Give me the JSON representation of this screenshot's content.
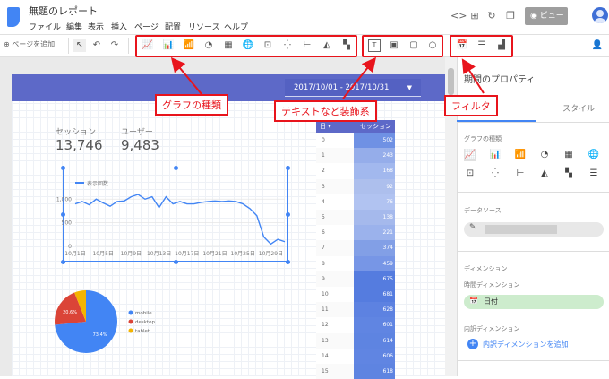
{
  "app": {
    "title": "無題のレポート"
  },
  "menu": [
    "ファイル",
    "編集",
    "表示",
    "挿入",
    "ページ",
    "配置",
    "リソース",
    "ヘルプ"
  ],
  "top_right": {
    "view_label": "ビュー"
  },
  "toolbar": {
    "add_page": "ページを追加"
  },
  "report": {
    "date_range": "2017/10/01 - 2017/10/31",
    "kpis": [
      {
        "label": "セッション",
        "value": "13,746"
      },
      {
        "label": "ユーザー",
        "value": "9,483"
      }
    ],
    "chart_data": [
      {
        "type": "line",
        "series": [
          {
            "name": "表示回数",
            "values": [
              900,
              950,
              880,
              1000,
              920,
              850,
              950,
              960,
              1050,
              1100,
              1000,
              1050,
              820,
              1050,
              900,
              950,
              900,
              900,
              930,
              950,
              960,
              950,
              960,
              950,
              900,
              800,
              650,
              200,
              50,
              150,
              100
            ]
          }
        ],
        "x": [
          "10月1日",
          "10月2日",
          "10月3日",
          "10月4日",
          "10月5日",
          "10月6日",
          "10月7日",
          "10月8日",
          "10月9日",
          "10月10日",
          "10月11日",
          "10月12日",
          "10月13日",
          "10月14日",
          "10月15日",
          "10月16日",
          "10月17日",
          "10月18日",
          "10月19日",
          "10月20日",
          "10月21日",
          "10月22日",
          "10月23日",
          "10月24日",
          "10月25日",
          "10月26日",
          "10月27日",
          "10月28日",
          "10月29日",
          "10月30日",
          "10月31日"
        ],
        "x_ticks": [
          "10月1日",
          "10月5日",
          "10月9日",
          "10月13日",
          "10月17日",
          "10月21日",
          "10月25日",
          "10月29日"
        ],
        "y_ticks": [
          "0",
          "500",
          "1,000"
        ],
        "ylim": [
          0,
          1100
        ]
      },
      {
        "type": "pie",
        "slices": [
          {
            "name": "mobile",
            "value": 73.4,
            "label": "73.4%",
            "color": "#4285f4"
          },
          {
            "name": "desktop",
            "value": 20.6,
            "label": "20.6%",
            "color": "#db4437"
          },
          {
            "name": "tablet",
            "value": 6.0,
            "label": "",
            "color": "#f4b400"
          }
        ]
      }
    ],
    "table": {
      "headers": [
        "日 ▾",
        "セッション"
      ],
      "rows": [
        [
          "0",
          "502"
        ],
        [
          "1",
          "243"
        ],
        [
          "2",
          "168"
        ],
        [
          "3",
          "92"
        ],
        [
          "4",
          "76"
        ],
        [
          "5",
          "138"
        ],
        [
          "6",
          "221"
        ],
        [
          "7",
          "374"
        ],
        [
          "8",
          "459"
        ],
        [
          "9",
          "675"
        ],
        [
          "10",
          "681"
        ],
        [
          "11",
          "628"
        ],
        [
          "12",
          "601"
        ],
        [
          "13",
          "614"
        ],
        [
          "14",
          "606"
        ],
        [
          "15",
          "618"
        ]
      ]
    }
  },
  "panel": {
    "title": "期間のプロパティ",
    "tab_style": "スタイル",
    "chart_types_label": "グラフの種類",
    "data_source_label": "データソース",
    "dimension_label": "ディメンション",
    "time_dimension_label": "時間ディメンション",
    "time_dimension_value": "日付",
    "breakdown_label": "内訳ディメンション",
    "add_breakdown": "内訳ディメンションを追加"
  },
  "annotations": {
    "graph_types": "グラフの種類",
    "text_decor": "テキストなど装飾系",
    "filter": "フィルタ"
  }
}
